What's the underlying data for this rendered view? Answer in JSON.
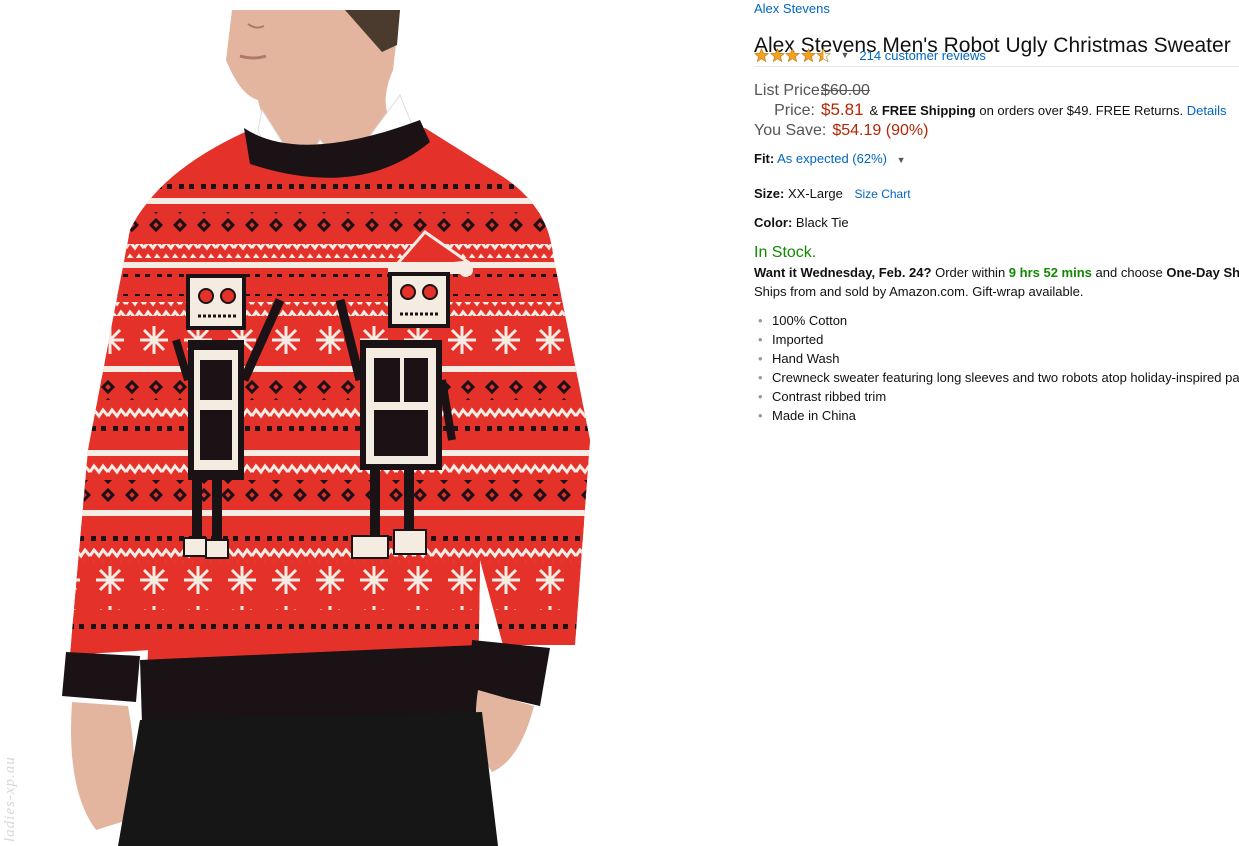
{
  "product": {
    "brand": "Alex Stevens",
    "title": "Alex Stevens Men's Robot Ugly Christmas Sweater",
    "rating": 4.5,
    "reviews_link": "214 customer reviews",
    "watermark": "ladies-xp.au"
  },
  "pricing": {
    "list_label": "List Price:",
    "list_value": "$60.00",
    "price_label": "Price:",
    "price_value": "$5.81",
    "amp": "&",
    "free_shipping": "FREE Shipping",
    "shipping_rest": "on orders over $49. FREE Returns.",
    "details_link": "Details",
    "save_label": "You Save:",
    "save_value": "$54.19 (90%)"
  },
  "fit": {
    "label": "Fit:",
    "value": "As expected (62%)"
  },
  "size": {
    "label": "Size:",
    "value": "XX-Large",
    "chart_link": "Size Chart"
  },
  "color": {
    "label": "Color:",
    "value": "Black Tie"
  },
  "availability": {
    "status": "In Stock.",
    "want_it": "Want it Wednesday, Feb. 24?",
    "order_within": "Order within",
    "countdown": "9 hrs 52 mins",
    "choose": "and choose",
    "one_day": "One-Day Sh",
    "ships_from": "Ships from and sold by Amazon.com. Gift-wrap available."
  },
  "features": [
    "100% Cotton",
    "Imported",
    "Hand Wash",
    "Crewneck sweater featuring long sleeves and two robots atop holiday-inspired pa",
    "Contrast ribbed trim",
    "Made in China"
  ],
  "colors": {
    "link": "#0066c0",
    "price": "#b12704",
    "stock": "#118a00",
    "star": "#f0a220",
    "sweater_red": "#e4322b"
  }
}
